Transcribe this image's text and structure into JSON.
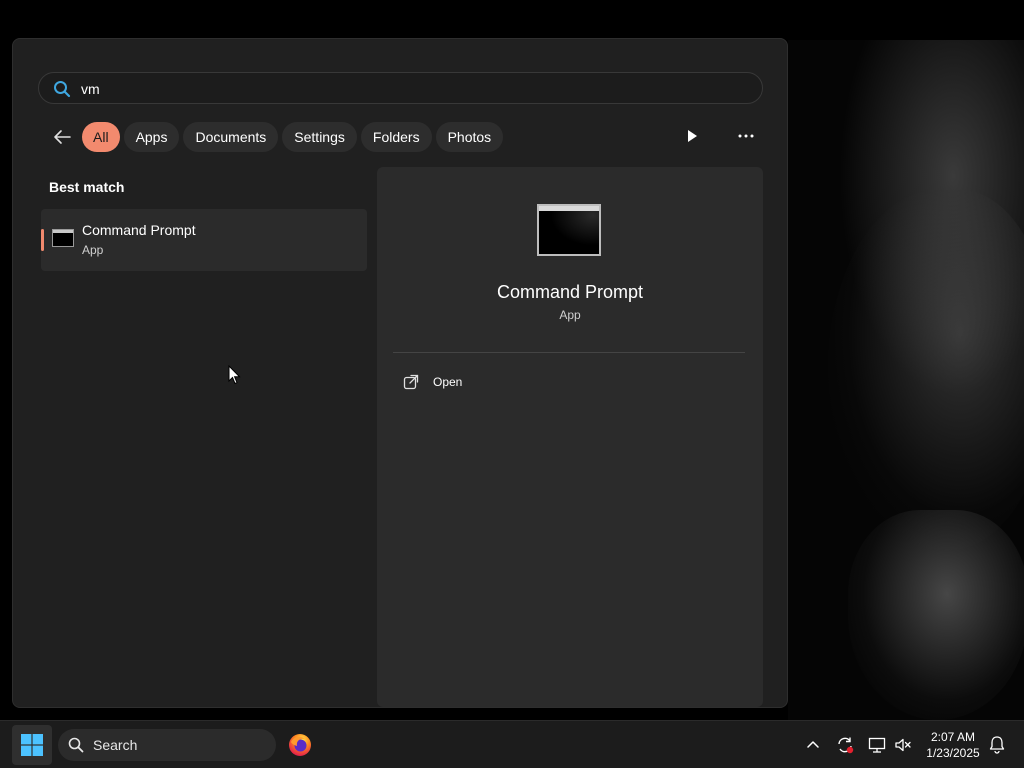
{
  "search": {
    "query": "vm"
  },
  "filters": [
    {
      "label": "All",
      "active": true
    },
    {
      "label": "Apps",
      "active": false
    },
    {
      "label": "Documents",
      "active": false
    },
    {
      "label": "Settings",
      "active": false
    },
    {
      "label": "Folders",
      "active": false
    },
    {
      "label": "Photos",
      "active": false
    }
  ],
  "results": {
    "heading": "Best match",
    "best_match": {
      "title": "Command Prompt",
      "subtitle": "App"
    }
  },
  "detail": {
    "app_name": "Command Prompt",
    "app_type": "App",
    "actions": [
      {
        "label": "Open",
        "icon": "open-external-icon"
      }
    ]
  },
  "taskbar": {
    "search_label": "Search",
    "pinned": [
      {
        "icon": "firefox-icon"
      }
    ],
    "tray_icons": [
      "chevron-up-icon",
      "sync-icon",
      "network-icon",
      "volume-muted-icon"
    ],
    "time": "2:07 AM",
    "date": "1/23/2025"
  },
  "colors": {
    "accent": "#f28a6e",
    "panel": "#202020",
    "pane": "#2b2b2b",
    "taskbar": "#1c1c1c"
  }
}
